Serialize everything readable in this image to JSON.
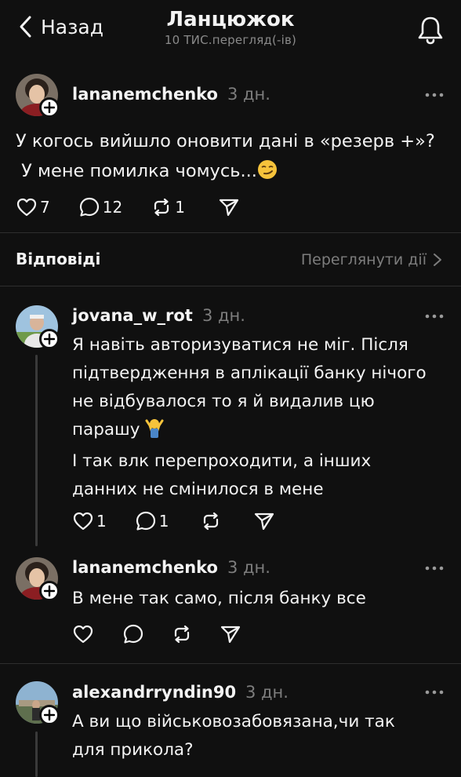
{
  "header": {
    "back_label": "Назад",
    "title": "Ланцюжок",
    "subtitle": "10 ТИС.перегляд(-ів)"
  },
  "main_post": {
    "username": "lananemchenko",
    "time": "3 дн.",
    "line1": "У когось вийшло оновити дані в «резерв +»?",
    "line2": "У мене помилка чомусь...",
    "emoji": "😏",
    "likes": "7",
    "comments": "12",
    "reposts": "1"
  },
  "replies_section": {
    "title": "Відповіді",
    "view_activity": "Переглянути дії"
  },
  "replies": [
    {
      "username": "jovana_w_rot",
      "time": "3 дн.",
      "lines": [
        "Я навіть авторизуватися не міг. Після",
        "підтвердження в аплікації банку нічого",
        "не відбувалося то я й видалив цю",
        "парашу",
        "І так влк перепроходити, а інших",
        "данних не смінилося в мене"
      ],
      "emoji": "🤷‍♂️",
      "likes": "1",
      "comments": "1"
    },
    {
      "username": "lananemchenko",
      "time": "3 дн.",
      "lines": [
        "В мене так само, після банку все"
      ]
    },
    {
      "username": "alexandrryndin90",
      "time": "3 дн.",
      "lines": [
        "А ви що військовозабовязана,чи так",
        "для прикола?"
      ]
    }
  ],
  "colors": {
    "background": "#101010",
    "text": "#f3f3f3",
    "muted": "#7d7d7d",
    "divider": "#2e2e2e"
  }
}
